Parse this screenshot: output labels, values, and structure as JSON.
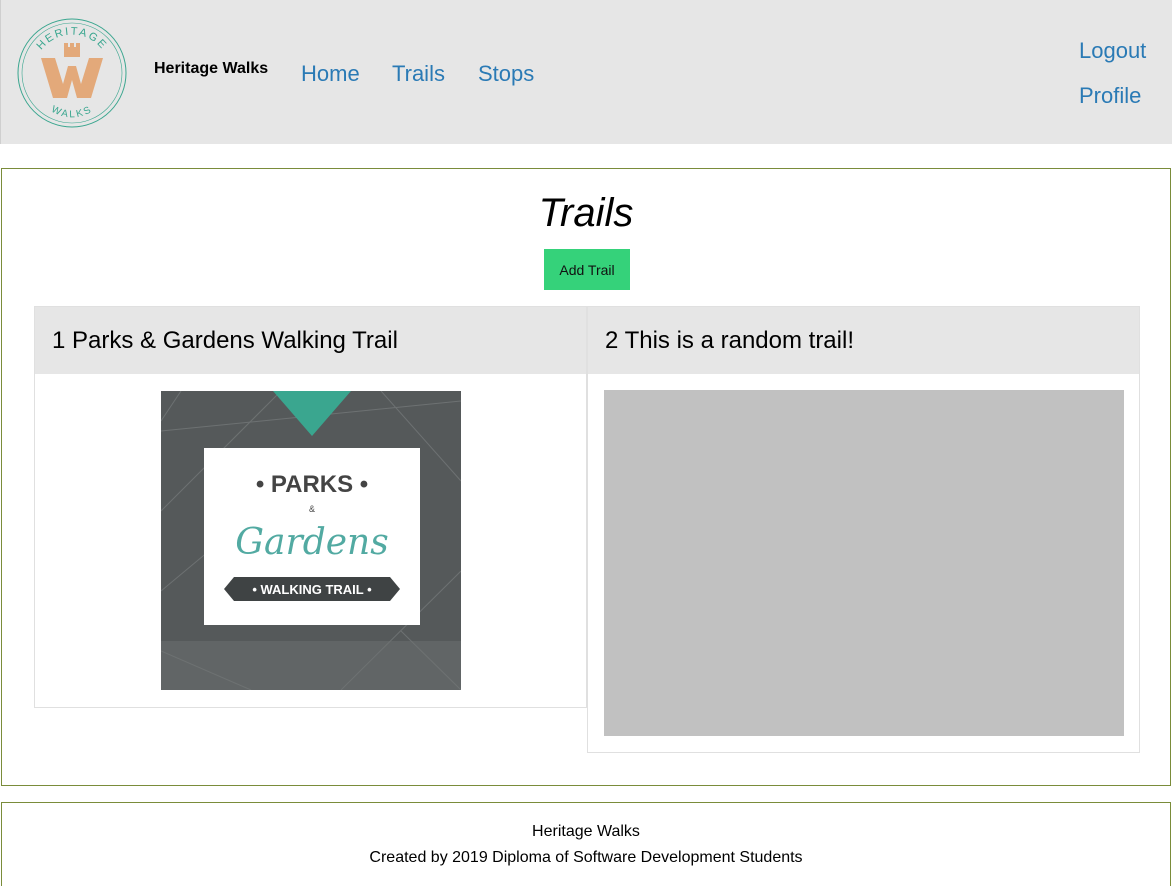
{
  "header": {
    "site_name": "Heritage Walks",
    "logo": {
      "top_text": "HERITAGE",
      "bottom_text": "WALKS",
      "accent": "#3aa68f",
      "brand": "#e3a97a"
    },
    "nav": [
      {
        "label": "Home"
      },
      {
        "label": "Trails"
      },
      {
        "label": "Stops"
      }
    ],
    "account": [
      {
        "label": "Logout"
      },
      {
        "label": "Profile"
      }
    ],
    "link_color": "#2a7ab5"
  },
  "main": {
    "title": "Trails",
    "add_button_label": "Add Trail",
    "add_button_color": "#35d27a",
    "trails": [
      {
        "title": "1 Parks & Gardens Walking Trail",
        "image": {
          "line1": "• PARKS •",
          "amp": "&",
          "script": "Gardens",
          "banner": "• WALKING TRAIL •"
        }
      },
      {
        "title": "2 This is a random trail!"
      }
    ]
  },
  "footer": {
    "line1": "Heritage Walks",
    "line2": "Created by 2019 Diploma of Software Development Students"
  }
}
